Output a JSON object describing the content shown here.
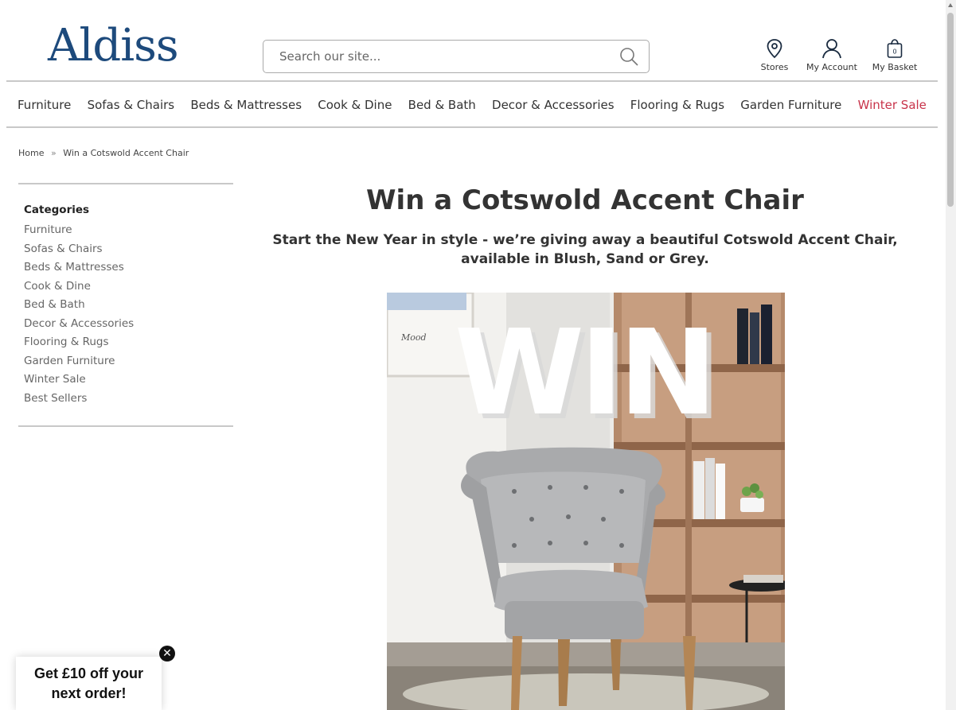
{
  "brand": {
    "logo_text": "Aldiss",
    "color": "#1d4a7c"
  },
  "search": {
    "placeholder": "Search our site...",
    "icon": "search-icon"
  },
  "header_links": {
    "stores": "Stores",
    "account": "My Account",
    "basket": "My Basket",
    "basket_count": "0"
  },
  "nav": {
    "items": [
      {
        "label": "Furniture"
      },
      {
        "label": "Sofas & Chairs"
      },
      {
        "label": "Beds & Mattresses"
      },
      {
        "label": "Cook & Dine"
      },
      {
        "label": "Bed & Bath"
      },
      {
        "label": "Decor & Accessories"
      },
      {
        "label": "Flooring & Rugs"
      },
      {
        "label": "Garden Furniture"
      },
      {
        "label": "Winter Sale"
      }
    ],
    "sale_color": "#c8334a"
  },
  "breadcrumb": {
    "home": "Home",
    "separator": "»",
    "current": "Win a Cotswold Accent Chair"
  },
  "sidebar": {
    "heading": "Categories",
    "items": [
      "Furniture",
      "Sofas & Chairs",
      "Beds & Mattresses",
      "Cook & Dine",
      "Bed & Bath",
      "Decor & Accessories",
      "Flooring & Rugs",
      "Garden Furniture",
      "Winter Sale",
      "Best Sellers"
    ]
  },
  "main": {
    "title": "Win a Cotswold Accent Chair",
    "subtitle": "Start the New Year in style - we’re giving away a beautiful Cotswold Accent Chair, available in Blush, Sand or Grey.",
    "hero_text": "WIN"
  },
  "promo": {
    "line1": "Get £10 off your",
    "line2": "next order!",
    "close": "✕"
  }
}
